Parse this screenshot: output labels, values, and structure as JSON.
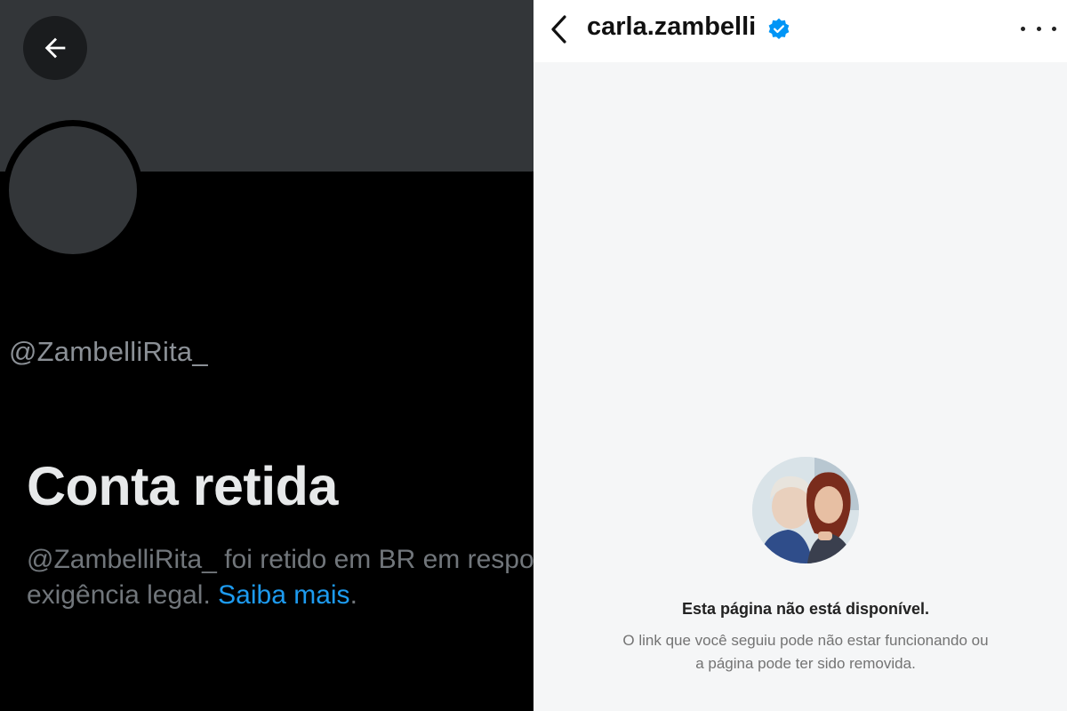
{
  "twitter": {
    "handle": "@ZambelliRita_",
    "withheld_title": "Conta retida",
    "withheld_message": "@ZambelliRita_ foi retido em BR em resposta a uma exigência legal.",
    "learn_more": "Saiba mais",
    "period": ".",
    "colors": {
      "background": "#000000",
      "banner": "#333639",
      "link": "#1d9bf0"
    }
  },
  "instagram": {
    "username": "carla.zambelli",
    "verified": true,
    "unavailable_title": "Esta página não está disponível.",
    "unavailable_line1": "O link que você seguiu pode não estar funcionando ou",
    "unavailable_line2": "a página pode ter sido removida.",
    "colors": {
      "background": "#f5f6f7",
      "verified": "#0095f6"
    }
  },
  "icons": [
    "arrow-left-icon",
    "chevron-left-icon",
    "verified-badge-icon",
    "more-horizontal-icon"
  ]
}
